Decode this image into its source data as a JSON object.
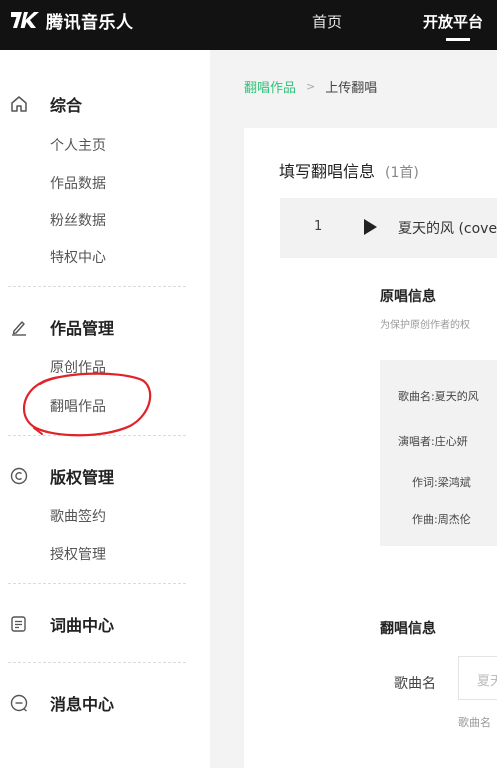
{
  "header": {
    "logo_text": "腾讯音乐人",
    "nav": [
      {
        "label": "首页"
      },
      {
        "label": "开放平台"
      }
    ],
    "colors": {
      "bg": "#121212",
      "text": "#ffffff"
    }
  },
  "sidebar": {
    "groups": [
      {
        "label": "综合",
        "icon": "home-icon",
        "items": [
          "个人主页",
          "作品数据",
          "粉丝数据",
          "特权中心"
        ]
      },
      {
        "label": "作品管理",
        "icon": "pencil-icon",
        "items": [
          "原创作品",
          "翻唱作品"
        ]
      },
      {
        "label": "版权管理",
        "icon": "copyright-icon",
        "items": [
          "歌曲签约",
          "授权管理"
        ]
      },
      {
        "label": "词曲中心",
        "icon": "lyrics-icon",
        "items": []
      },
      {
        "label": "消息中心",
        "icon": "message-icon",
        "items": []
      }
    ],
    "annotation": "red-hand-drawn-circle"
  },
  "breadcrumb": {
    "parent": "翻唱作品",
    "separator": ">",
    "current": "上传翻唱"
  },
  "card": {
    "title": "填写翻唱信息",
    "count": "(1首)",
    "song": {
      "index": "1",
      "name": "夏天的风 (cove"
    },
    "original_section": {
      "title": "原唱信息",
      "desc": "为保护原创作者的权",
      "fields": [
        {
          "label": "歌曲名:",
          "value": "夏天的风"
        },
        {
          "label": "演唱者:",
          "value": "庄心妍"
        },
        {
          "label": "作词:",
          "value": "梁鸿斌"
        },
        {
          "label": "作曲:",
          "value": "周杰伦"
        }
      ]
    },
    "cover_section": {
      "title": "翻唱信息",
      "song_name_label": "歌曲名",
      "song_name_value": "夏天",
      "song_name_hint": "歌曲名"
    }
  },
  "colors": {
    "accent": "#31c27c",
    "annotation": "#e0222a",
    "page_bg": "#f3f3f3"
  }
}
